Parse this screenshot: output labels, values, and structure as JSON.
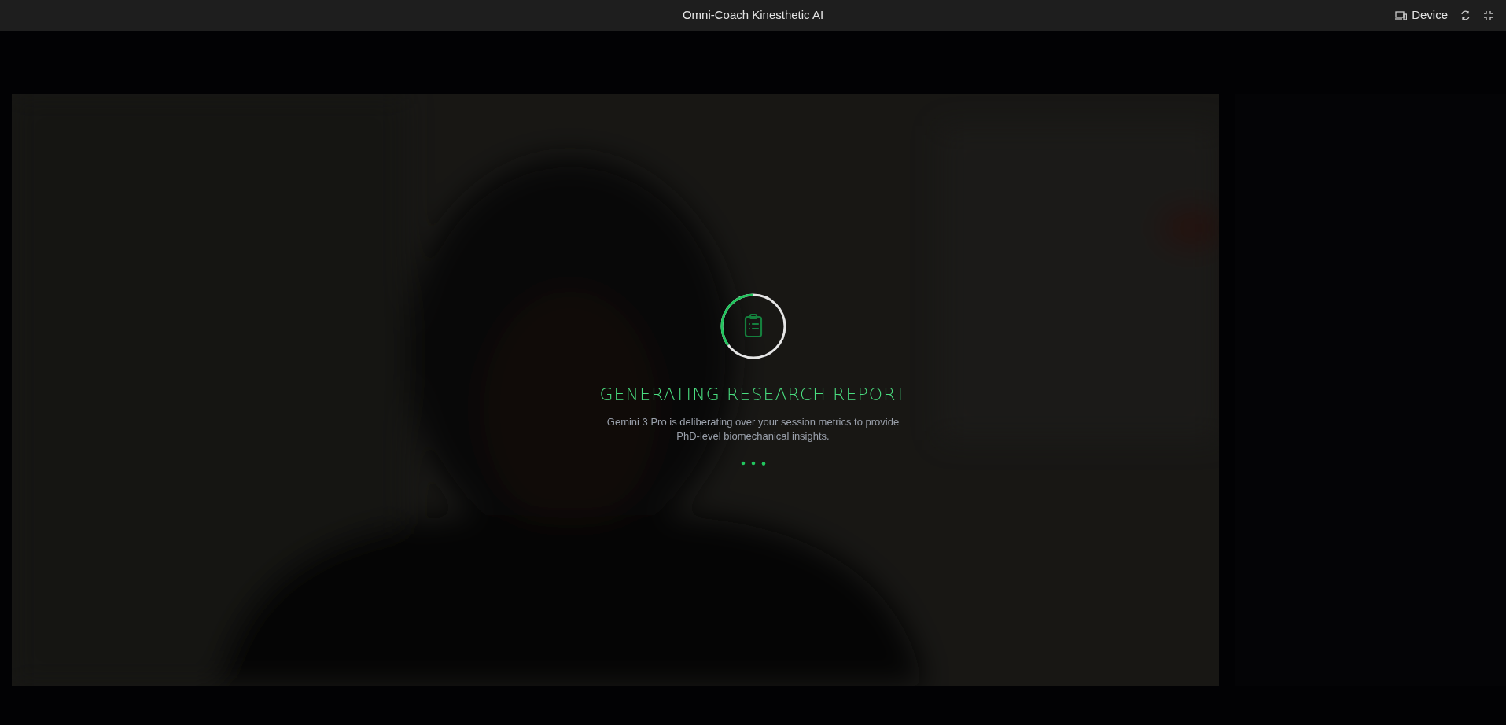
{
  "window": {
    "title": "Omni-Coach Kinesthetic AI",
    "device_label": "Device"
  },
  "overlay": {
    "title": "GENERATING RESEARCH REPORT",
    "message": "Gemini 3 Pro is deliberating over your session metrics to provide PhD-level biomechanical insights."
  }
}
